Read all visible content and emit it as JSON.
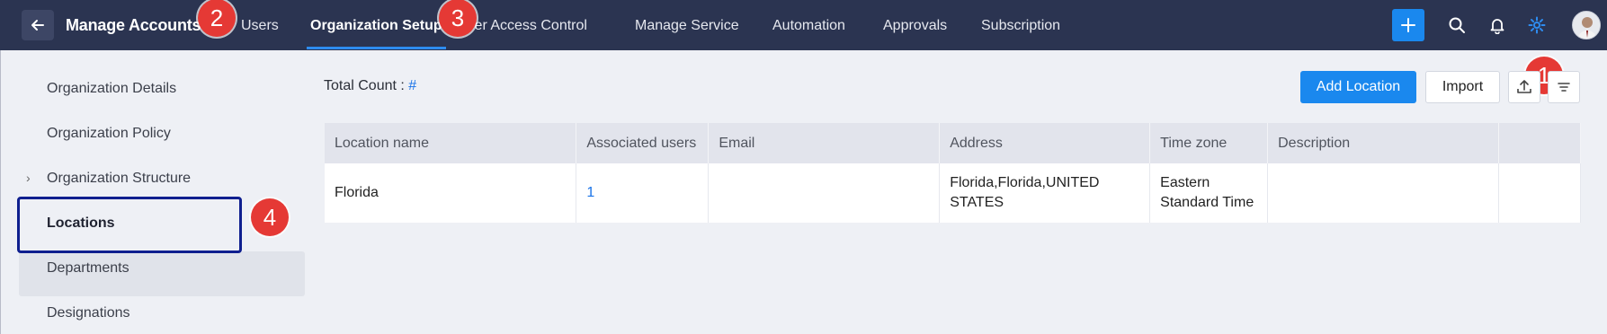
{
  "header": {
    "title": "Manage Accounts",
    "tabs": [
      {
        "label": "Users"
      },
      {
        "label": "Organization Setup",
        "active": true
      },
      {
        "label": "User Access Control"
      },
      {
        "label": "Manage Service"
      },
      {
        "label": "Automation"
      },
      {
        "label": "Approvals"
      },
      {
        "label": "Subscription"
      }
    ],
    "icons": [
      "back-arrow-icon",
      "plus-icon",
      "search-icon",
      "bell-icon",
      "gear-icon",
      "avatar"
    ]
  },
  "markers": [
    "1",
    "2",
    "3",
    "4"
  ],
  "sidebar": {
    "items": [
      {
        "label": "Organization Details"
      },
      {
        "label": "Organization Policy"
      },
      {
        "label": "Organization Structure",
        "expandable": true
      },
      {
        "label": "Locations",
        "active": true
      },
      {
        "label": "Departments"
      },
      {
        "label": "Designations"
      }
    ]
  },
  "content": {
    "total_count_label": "Total Count :",
    "total_count_value": "#",
    "add_button": "Add Location",
    "import_button": "Import",
    "table": {
      "headers": [
        "Location name",
        "Associated users",
        "Email",
        "Address",
        "Time zone",
        "Description",
        ""
      ],
      "rows": [
        [
          "Florida",
          "1",
          "",
          "Florida,Florida,UNITED STATES",
          "Eastern Standard Time",
          "",
          ""
        ]
      ]
    }
  },
  "colors": {
    "topbar": "#2b3451",
    "accent": "#1a88ee",
    "marker": "#e53935",
    "highlight_box": "#0f1f8f"
  }
}
